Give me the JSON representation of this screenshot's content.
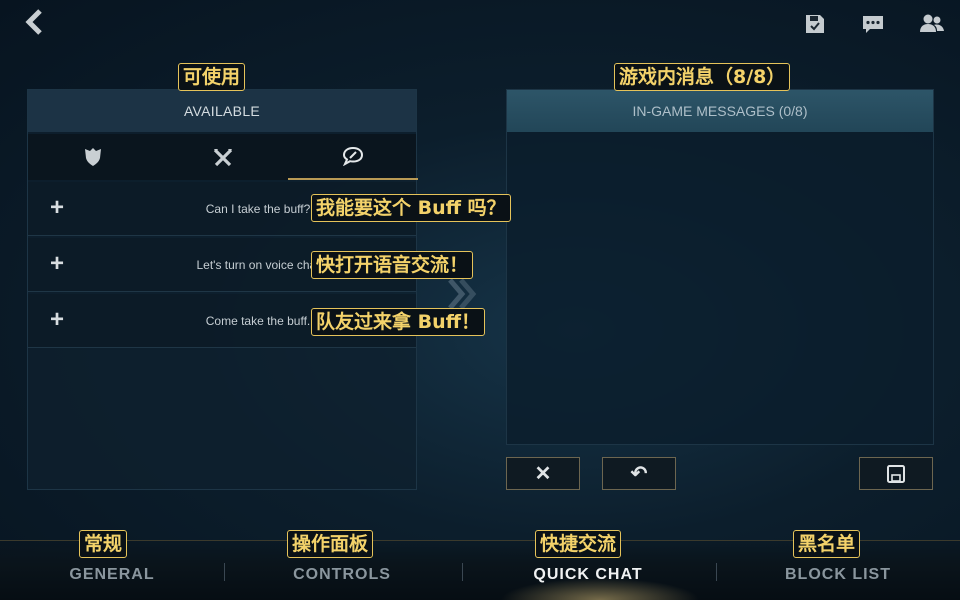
{
  "colors": {
    "accent_gold": "#e5c35a",
    "panel_bg": "#0e202e",
    "header_teal": "#2d5568"
  },
  "top_bar": {
    "back_icon": "chevron-left-icon",
    "icons": [
      "save-icon",
      "chat-icon",
      "friends-icon"
    ]
  },
  "annotations": {
    "available": "可使用",
    "in_game": "游戏内消息（8/8）",
    "msg_1": "我能要这个 Buff 吗？",
    "msg_2": "快打开语音交流！",
    "msg_3": "队友过来拿 Buff！",
    "tab_general": "常规",
    "tab_controls": "操作面板",
    "tab_quick_chat": "快捷交流",
    "tab_block_list": "黑名单"
  },
  "left_panel": {
    "title": "AVAILABLE",
    "category_tabs": [
      {
        "icon": "shield-icon"
      },
      {
        "icon": "crossed-swords-icon"
      },
      {
        "icon": "chat-bubble-icon",
        "active": true
      }
    ],
    "messages": [
      {
        "text": "Can I take the buff?"
      },
      {
        "text": "Let's turn on voice chat"
      },
      {
        "text": "Come take the buff."
      }
    ]
  },
  "right_panel": {
    "title": "IN-GAME MESSAGES (0/8)"
  },
  "actions": {
    "clear_label": "✕",
    "undo_label": "↶",
    "save_icon": "save-icon"
  },
  "bottom_tabs": [
    {
      "label": "GENERAL"
    },
    {
      "label": "CONTROLS"
    },
    {
      "label": "QUICK CHAT",
      "active": true
    },
    {
      "label": "BLOCK LIST"
    }
  ]
}
